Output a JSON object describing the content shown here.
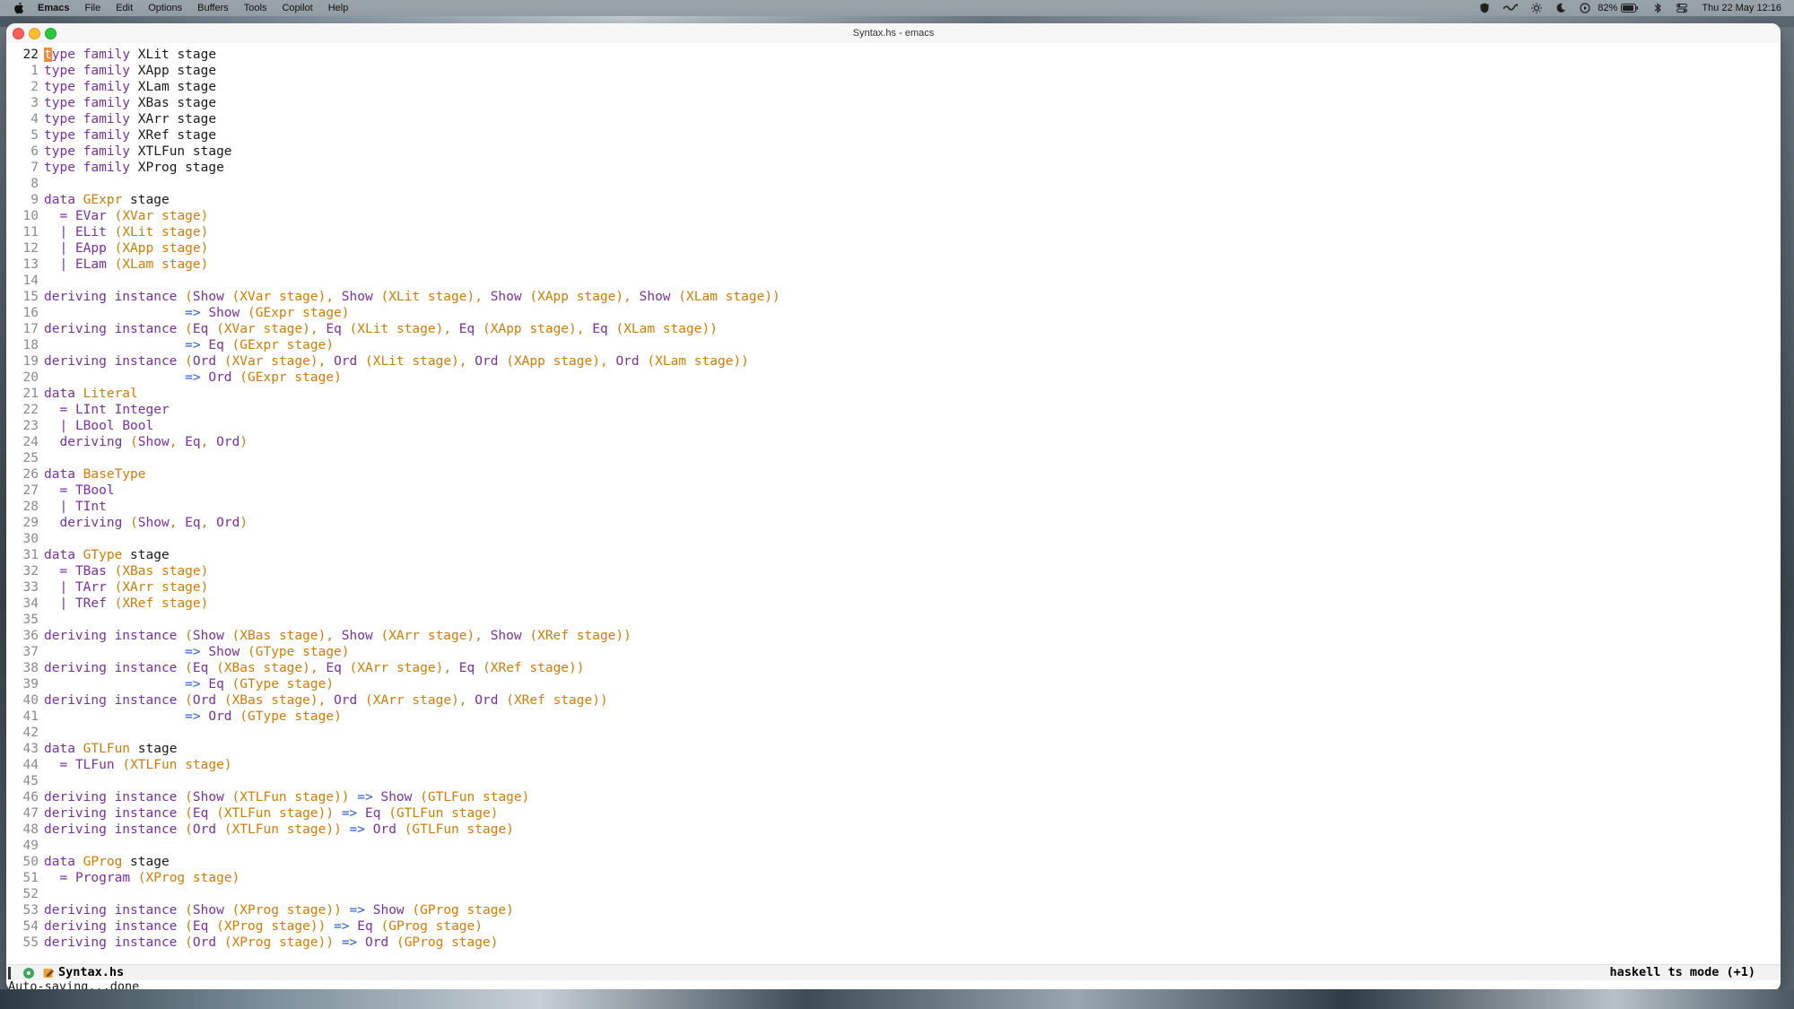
{
  "menubar": {
    "app": "Emacs",
    "items": [
      "File",
      "Edit",
      "Options",
      "Buffers",
      "Tools",
      "Copilot",
      "Help"
    ],
    "battery": "82%",
    "clock": "Thu 22 May  12:16"
  },
  "window": {
    "title": "Syntax.hs - emacs"
  },
  "editor": {
    "cursor_line": 22,
    "lines": [
      {
        "n": "22",
        "text": "type family XLit stage"
      },
      {
        "n": "1",
        "text": "type family XApp stage"
      },
      {
        "n": "2",
        "text": "type family XLam stage"
      },
      {
        "n": "3",
        "text": "type family XBas stage"
      },
      {
        "n": "4",
        "text": "type family XArr stage"
      },
      {
        "n": "5",
        "text": "type family XRef stage"
      },
      {
        "n": "6",
        "text": "type family XTLFun stage"
      },
      {
        "n": "7",
        "text": "type family XProg stage"
      },
      {
        "n": "8",
        "text": ""
      },
      {
        "n": "9",
        "text": "data GExpr stage"
      },
      {
        "n": "10",
        "text": "  = EVar (XVar stage)"
      },
      {
        "n": "11",
        "text": "  | ELit (XLit stage)"
      },
      {
        "n": "12",
        "text": "  | EApp (XApp stage)"
      },
      {
        "n": "13",
        "text": "  | ELam (XLam stage)"
      },
      {
        "n": "14",
        "text": ""
      },
      {
        "n": "15",
        "text": "deriving instance (Show (XVar stage), Show (XLit stage), Show (XApp stage), Show (XLam stage))"
      },
      {
        "n": "16",
        "text": "                  => Show (GExpr stage)"
      },
      {
        "n": "17",
        "text": "deriving instance (Eq (XVar stage), Eq (XLit stage), Eq (XApp stage), Eq (XLam stage))"
      },
      {
        "n": "18",
        "text": "                  => Eq (GExpr stage)"
      },
      {
        "n": "19",
        "text": "deriving instance (Ord (XVar stage), Ord (XLit stage), Ord (XApp stage), Ord (XLam stage))"
      },
      {
        "n": "20",
        "text": "                  => Ord (GExpr stage)"
      },
      {
        "n": "21",
        "text": "data Literal"
      },
      {
        "n": "22",
        "text": "  = LInt Integer"
      },
      {
        "n": "23",
        "text": "  | LBool Bool"
      },
      {
        "n": "24",
        "text": "  deriving (Show, Eq, Ord)"
      },
      {
        "n": "25",
        "text": ""
      },
      {
        "n": "26",
        "text": "data BaseType"
      },
      {
        "n": "27",
        "text": "  = TBool"
      },
      {
        "n": "28",
        "text": "  | TInt"
      },
      {
        "n": "29",
        "text": "  deriving (Show, Eq, Ord)"
      },
      {
        "n": "30",
        "text": ""
      },
      {
        "n": "31",
        "text": "data GType stage"
      },
      {
        "n": "32",
        "text": "  = TBas (XBas stage)"
      },
      {
        "n": "33",
        "text": "  | TArr (XArr stage)"
      },
      {
        "n": "34",
        "text": "  | TRef (XRef stage)"
      },
      {
        "n": "35",
        "text": ""
      },
      {
        "n": "36",
        "text": "deriving instance (Show (XBas stage), Show (XArr stage), Show (XRef stage))"
      },
      {
        "n": "37",
        "text": "                  => Show (GType stage)"
      },
      {
        "n": "38",
        "text": "deriving instance (Eq (XBas stage), Eq (XArr stage), Eq (XRef stage))"
      },
      {
        "n": "39",
        "text": "                  => Eq (GType stage)"
      },
      {
        "n": "40",
        "text": "deriving instance (Ord (XBas stage), Ord (XArr stage), Ord (XRef stage))"
      },
      {
        "n": "41",
        "text": "                  => Ord (GType stage)"
      },
      {
        "n": "42",
        "text": ""
      },
      {
        "n": "43",
        "text": "data GTLFun stage"
      },
      {
        "n": "44",
        "text": "  = TLFun (XTLFun stage)"
      },
      {
        "n": "45",
        "text": ""
      },
      {
        "n": "46",
        "text": "deriving instance (Show (XTLFun stage)) => Show (GTLFun stage)"
      },
      {
        "n": "47",
        "text": "deriving instance (Eq (XTLFun stage)) => Eq (GTLFun stage)"
      },
      {
        "n": "48",
        "text": "deriving instance (Ord (XTLFun stage)) => Ord (GTLFun stage)"
      },
      {
        "n": "49",
        "text": ""
      },
      {
        "n": "50",
        "text": "data GProg stage"
      },
      {
        "n": "51",
        "text": "  = Program (XProg stage)"
      },
      {
        "n": "52",
        "text": ""
      },
      {
        "n": "53",
        "text": "deriving instance (Show (XProg stage)) => Show (GProg stage)"
      },
      {
        "n": "54",
        "text": "deriving instance (Eq (XProg stage)) => Eq (GProg stage)"
      },
      {
        "n": "55",
        "text": "deriving instance (Ord (XProg stage)) => Ord (GProg stage)"
      }
    ]
  },
  "modeline": {
    "buffer": "Syntax.hs",
    "mode": "haskell ts mode (+1)"
  },
  "echo_area": "Auto-saving...done",
  "colors": {
    "keyword": "#7b2ea6",
    "type": "#d77a00",
    "arrow": "#2c5ed8",
    "cursor": "#f0883e"
  }
}
